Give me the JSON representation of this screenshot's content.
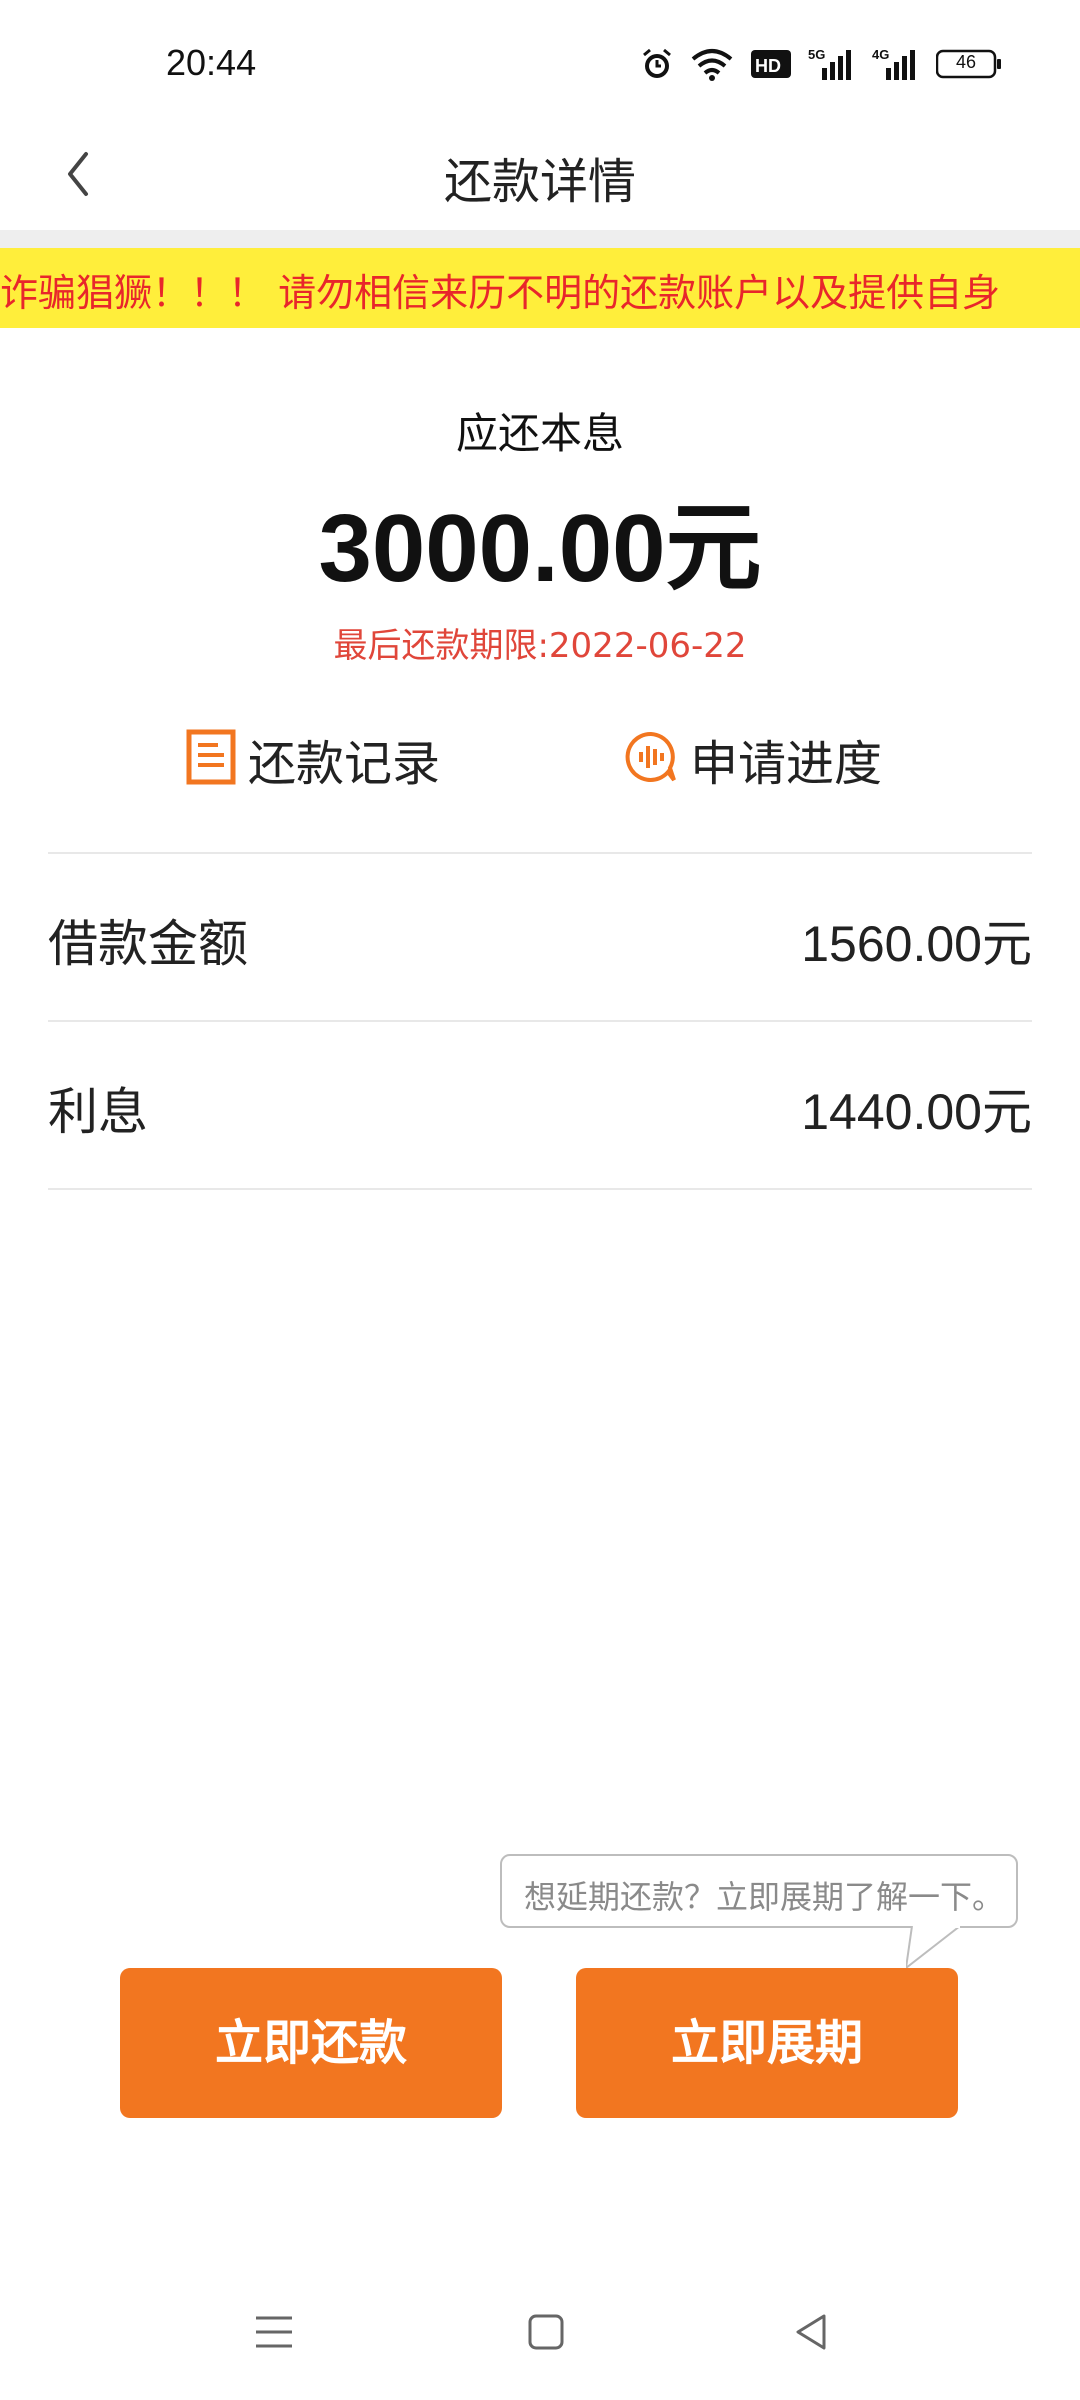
{
  "status_bar": {
    "time": "20:44",
    "network_1": "5G",
    "network_2": "4G",
    "battery": "46",
    "icons": [
      "alarm-icon",
      "wifi-icon",
      "hd-icon",
      "signal-icon",
      "battery-icon"
    ]
  },
  "header": {
    "title": "还款详情"
  },
  "banner": {
    "text": "诈骗猖獗！！！ 请勿相信来历不明的还款账户以及提供自身"
  },
  "summary": {
    "label": "应还本息",
    "amount": "3000.00元",
    "deadline": "最后还款期限:2022-06-22"
  },
  "links": {
    "record": "还款记录",
    "progress": "申请进度"
  },
  "details": [
    {
      "label": "借款金额",
      "value": "1560.00元"
    },
    {
      "label": "利息",
      "value": "1440.00元"
    }
  ],
  "tooltip": {
    "text": "想延期还款？立即展期了解一下。"
  },
  "actions": {
    "repay": "立即还款",
    "extend": "立即展期"
  },
  "colors": {
    "accent": "#f27620",
    "warning_bg": "#ffee3b",
    "warning_text": "#e8262b",
    "deadline": "#e0463a"
  }
}
